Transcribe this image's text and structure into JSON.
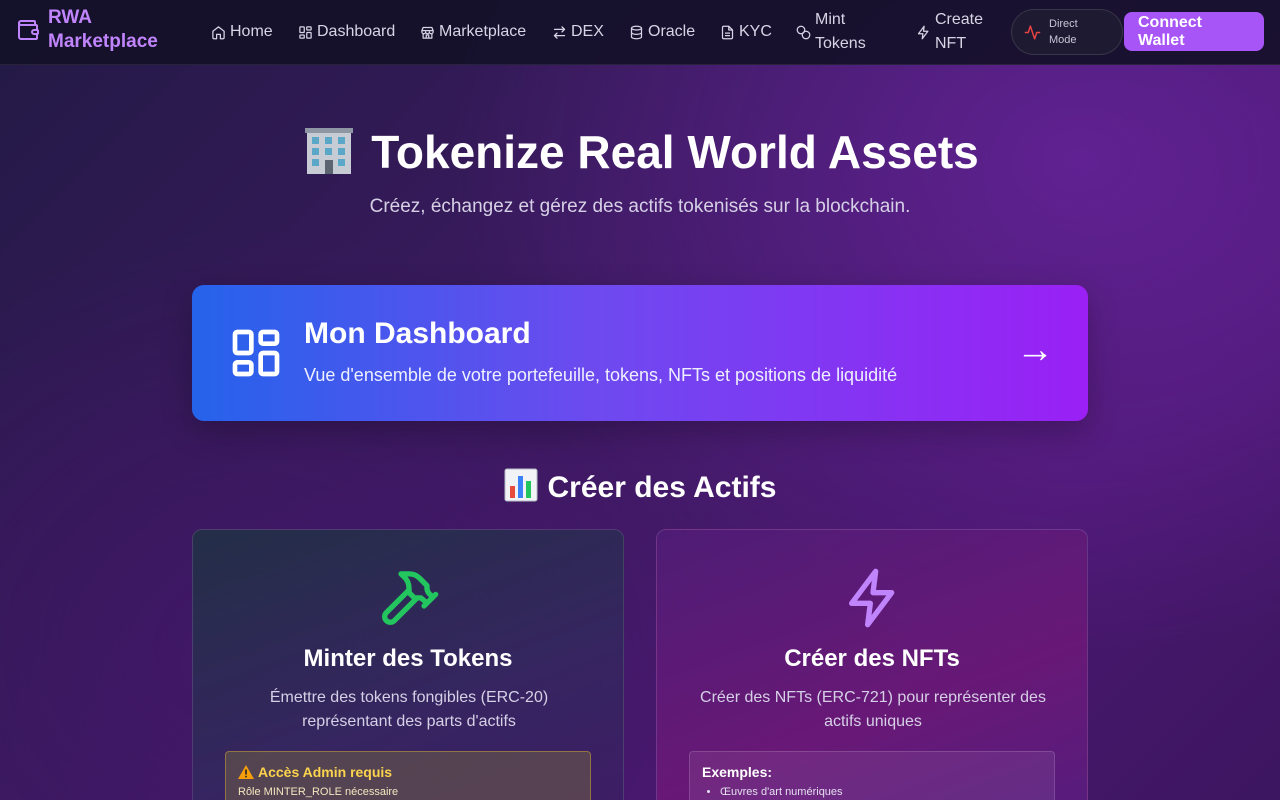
{
  "nav": {
    "brand_line1": "RWA",
    "brand_line2": "Marketplace",
    "items": [
      {
        "label": "Home",
        "icon": "home-icon"
      },
      {
        "label": "Dashboard",
        "icon": "dashboard-icon"
      },
      {
        "label": "Marketplace",
        "icon": "store-icon"
      },
      {
        "label": "DEX",
        "icon": "swap-icon"
      },
      {
        "label": "Oracle",
        "icon": "database-icon"
      },
      {
        "label": "KYC",
        "icon": "document-icon"
      },
      {
        "label_line1": "Mint",
        "label_line2": "Tokens",
        "icon": "coins-icon"
      },
      {
        "label_line1": "Create",
        "label_line2": "NFT",
        "icon": "zap-icon"
      }
    ],
    "direct_mode_line1": "Direct",
    "direct_mode_line2": "Mode",
    "connect_line1": "Connect",
    "connect_line2": "Wallet"
  },
  "hero": {
    "title": "Tokenize Real World Assets",
    "subtitle": "Créez, échangez et gérez des actifs tokenisés sur la blockchain."
  },
  "dashboard_card": {
    "title": "Mon Dashboard",
    "description": "Vue d'ensemble de votre portefeuille, tokens, NFTs et positions de liquidité",
    "arrow": "→"
  },
  "section": {
    "title": "Créer des Actifs"
  },
  "cards": {
    "tokens": {
      "title": "Minter des Tokens",
      "description": "Émettre des tokens fongibles (ERC-20) représentant des parts d'actifs",
      "warn_title": "Accès Admin requis",
      "warn_text": "Rôle MINTER_ROLE nécessaire"
    },
    "nfts": {
      "title": "Créer des NFTs",
      "description": "Créer des NFTs (ERC-721) pour représenter des actifs uniques",
      "examples_title": "Exemples:",
      "examples": [
        "Œuvres d'art numériques"
      ]
    }
  },
  "colors": {
    "brand": "#c084fc",
    "connect": "#a855f7",
    "token_icon": "#22c55e",
    "nft_icon": "#c084fc",
    "warn": "#fcd34d"
  }
}
